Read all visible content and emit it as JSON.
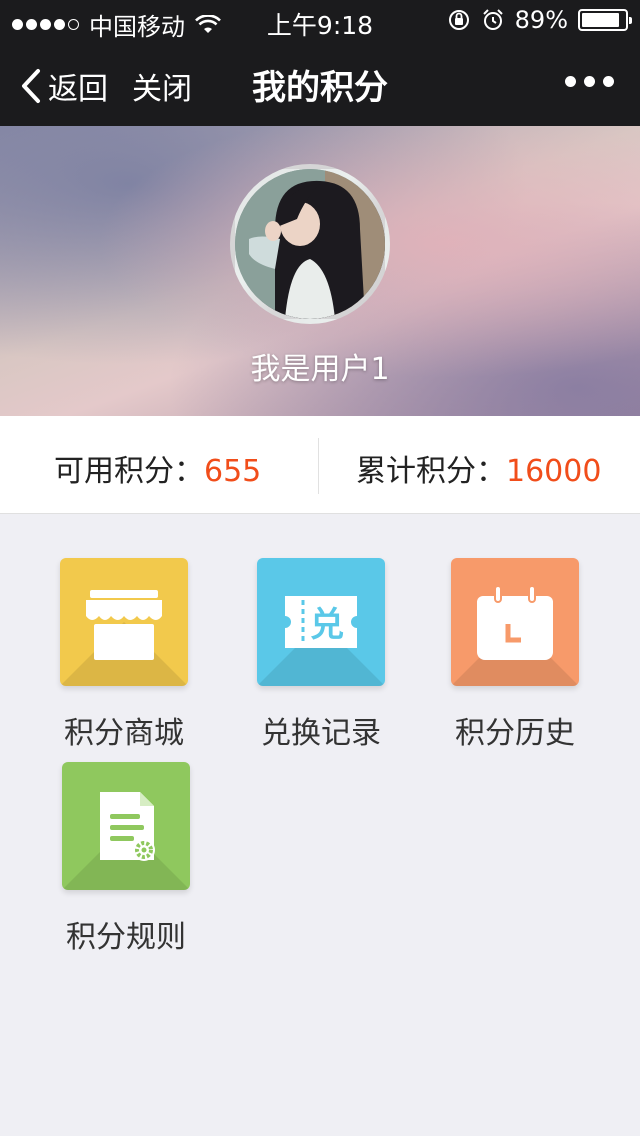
{
  "status_bar": {
    "carrier": "中国移动",
    "time": "上午9:18",
    "battery": "89%",
    "battery_level": 0.89,
    "icons": [
      "signal-dots-icon",
      "wifi-icon",
      "rotation-lock-icon",
      "alarm-icon",
      "battery-icon"
    ]
  },
  "nav": {
    "back_label": "返回",
    "close_label": "关闭",
    "title": "我的积分"
  },
  "profile": {
    "username": "我是用户1"
  },
  "points": {
    "available_label": "可用积分：",
    "available_value": "655",
    "total_label": "累计积分：",
    "total_value": "16000"
  },
  "menu": {
    "items": [
      {
        "label": "积分商城",
        "icon": "store-icon",
        "color": "#f2c94c"
      },
      {
        "label": "兑换记录",
        "icon": "ticket-icon",
        "color": "#5ac8e8"
      },
      {
        "label": "积分历史",
        "icon": "calendar-icon",
        "color": "#f79a6a"
      },
      {
        "label": "积分规则",
        "icon": "document-settings-icon",
        "color": "#8fc85e"
      }
    ],
    "ticket_char": "兑"
  },
  "colors": {
    "accent": "#f14d1a",
    "nav_bg": "#1b1b1d",
    "page_bg": "#efeff4"
  }
}
